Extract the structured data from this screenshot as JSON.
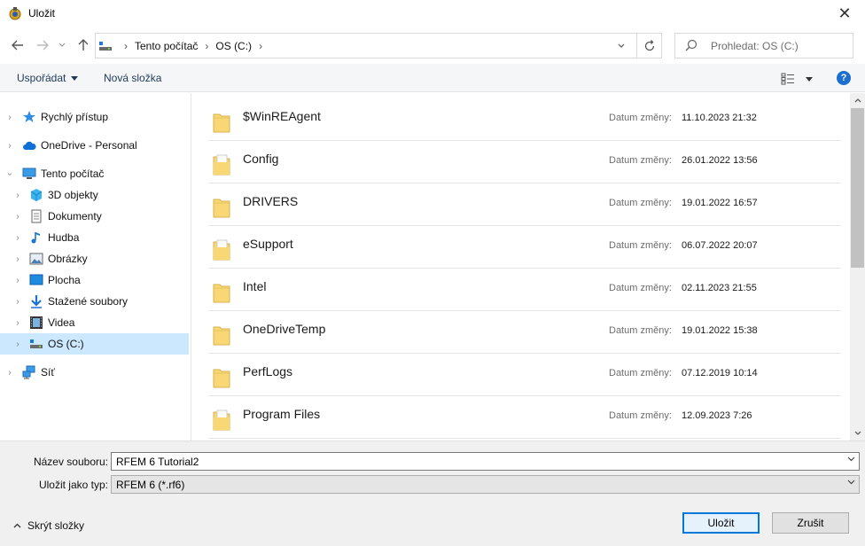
{
  "window": {
    "title": "Uložit",
    "close_label": "✕"
  },
  "nav": {
    "breadcrumbs": [
      "Tento počítač",
      "OS (C:)"
    ],
    "search_placeholder": "Prohledat: OS (C:)"
  },
  "toolbar": {
    "organize_label": "Uspořádat",
    "new_folder_label": "Nová složka",
    "help_label": "?"
  },
  "sidebar": {
    "items": [
      {
        "label": "Rychlý přístup",
        "icon": "star-icon"
      },
      {
        "label": "OneDrive - Personal",
        "icon": "cloud-icon"
      },
      {
        "label": "Tento počítač",
        "icon": "computer-icon"
      },
      {
        "label": "3D objekty",
        "icon": "cube-icon"
      },
      {
        "label": "Dokumenty",
        "icon": "document-icon"
      },
      {
        "label": "Hudba",
        "icon": "music-icon"
      },
      {
        "label": "Obrázky",
        "icon": "picture-icon"
      },
      {
        "label": "Plocha",
        "icon": "desktop-icon"
      },
      {
        "label": "Stažené soubory",
        "icon": "download-icon"
      },
      {
        "label": "Videa",
        "icon": "video-icon"
      },
      {
        "label": "OS (C:)",
        "icon": "drive-icon",
        "selected": true
      },
      {
        "label": "Síť",
        "icon": "network-icon"
      }
    ]
  },
  "files": {
    "date_label": "Datum změny:",
    "rows": [
      {
        "name": "$WinREAgent",
        "date": "11.10.2023 21:32"
      },
      {
        "name": "Config",
        "date": "26.01.2022 13:56"
      },
      {
        "name": "DRIVERS",
        "date": "19.01.2022 16:57"
      },
      {
        "name": "eSupport",
        "date": "06.07.2022 20:07"
      },
      {
        "name": "Intel",
        "date": "02.11.2023 21:55"
      },
      {
        "name": "OneDriveTemp",
        "date": "19.01.2022 15:38"
      },
      {
        "name": "PerfLogs",
        "date": "07.12.2019 10:14"
      },
      {
        "name": "Program Files",
        "date": "12.09.2023 7:26"
      }
    ]
  },
  "form": {
    "filename_label": "Název souboru:",
    "filename_value": "RFEM 6 Tutorial2",
    "type_label": "Uložit jako typ:",
    "type_value": "RFEM 6 (*.rf6)",
    "hide_folders_label": "Skrýt složky",
    "save_label": "Uložit",
    "cancel_label": "Zrušit"
  },
  "colors": {
    "accent": "#0078d7",
    "selection": "#cce8ff",
    "folder": "#f8d775"
  }
}
